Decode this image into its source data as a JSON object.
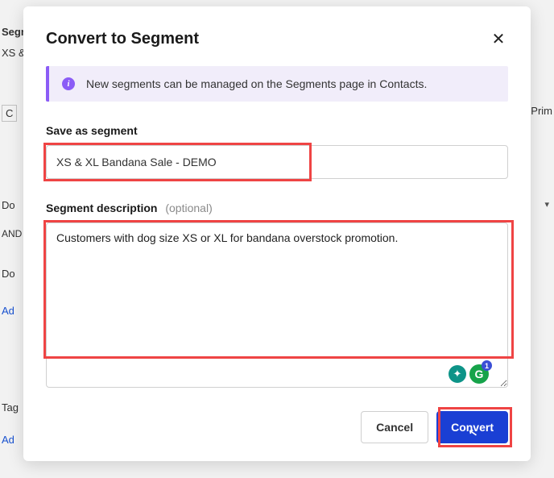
{
  "background": {
    "segm": "Segm",
    "xs": "XS &",
    "c": "C",
    "do1": "Do",
    "and": "AND",
    "do2": "Do",
    "ad1": "Ad",
    "tag": "Tag",
    "ad2": "Ad",
    "prim": "Prim",
    "caret": "▾"
  },
  "modal": {
    "title": "Convert to Segment",
    "info_text": "New segments can be managed on the Segments page in Contacts.",
    "info_icon": "i",
    "save_label": "Save as segment",
    "name_value": "XS & XL Bandana Sale - DEMO",
    "desc_label": "Segment description",
    "desc_optional": "(optional)",
    "desc_value": "Customers with dog size XS or XL for bandana overstock promotion.",
    "tool_badge_count": "1",
    "cancel_label": "Cancel",
    "convert_label": "Convert"
  }
}
